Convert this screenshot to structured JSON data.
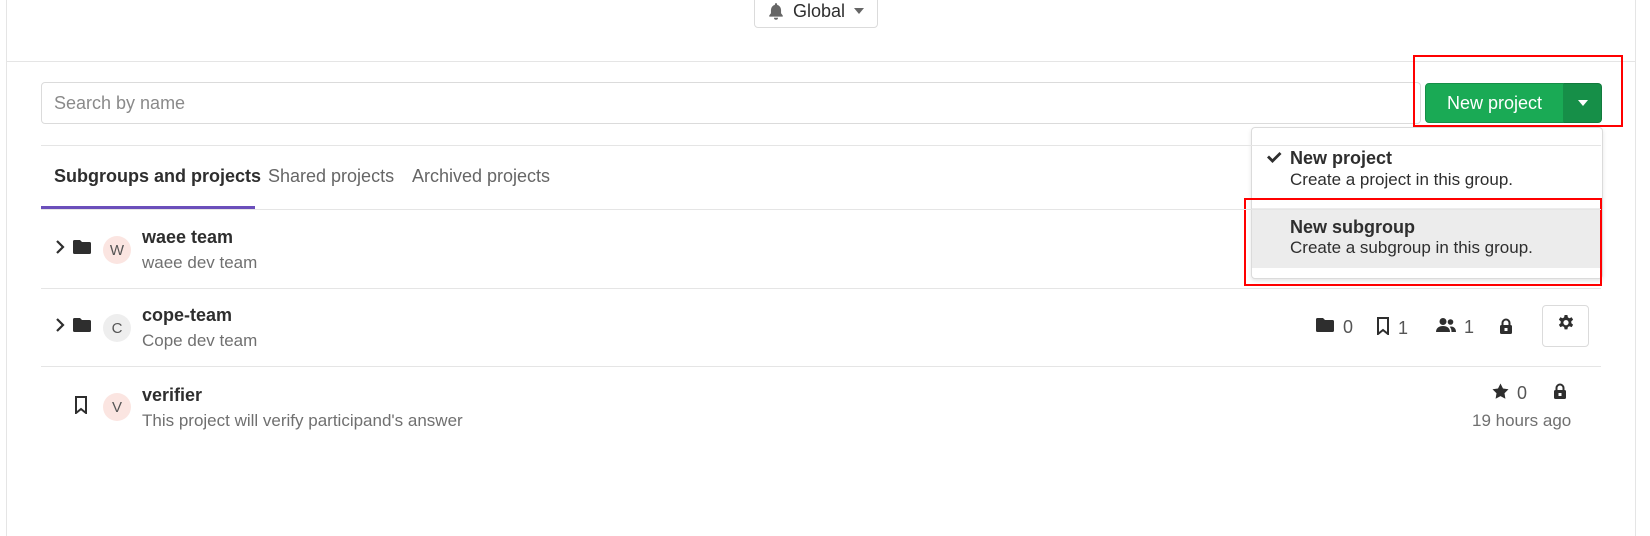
{
  "notification": {
    "label": "Global"
  },
  "search": {
    "placeholder": "Search by name",
    "value": ""
  },
  "new_project_button": {
    "label": "New project"
  },
  "dropdown": {
    "items": [
      {
        "title": "New project",
        "description": "Create a project in this group.",
        "checked": true
      },
      {
        "title": "New subgroup",
        "description": "Create a subgroup in this group.",
        "checked": false,
        "hovered": true
      }
    ]
  },
  "tabs": [
    {
      "label": "Subgroups and projects",
      "active": true
    },
    {
      "label": "Shared projects",
      "active": false
    },
    {
      "label": "Archived projects",
      "active": false
    }
  ],
  "rows": [
    {
      "type": "group",
      "avatar": "W",
      "name": "waee team",
      "description": "waee dev team"
    },
    {
      "type": "group",
      "avatar": "C",
      "name": "cope-team",
      "description": "Cope dev team",
      "stats": {
        "subgroups": "0",
        "projects": "1",
        "members": "1"
      }
    },
    {
      "type": "project",
      "avatar": "V",
      "name": "verifier",
      "description": "This project will verify participand's answer",
      "stars": "0",
      "updated": "19 hours ago"
    }
  ],
  "colors": {
    "primary_green": "#1aaa55",
    "tab_accent": "#6b4fbb",
    "highlight": "#ff0000"
  }
}
